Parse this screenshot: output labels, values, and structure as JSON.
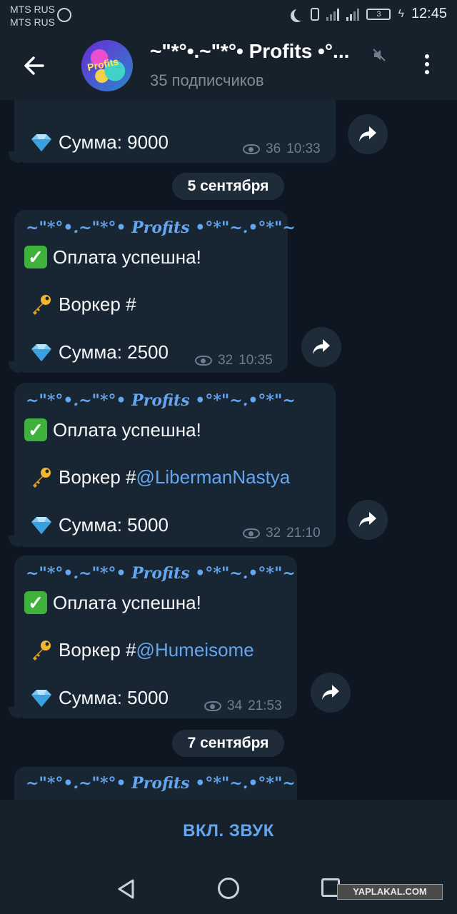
{
  "status_bar": {
    "carrier_1": "MTS RUS",
    "carrier_2": "MTS RUS",
    "battery": "3",
    "time": "12:45"
  },
  "header": {
    "channel_title": "~\"*°•.~\"*°• Profits •°...",
    "subscribers": "35 подписчиков",
    "avatar_text": "Profits"
  },
  "messages": [
    {
      "amount": "Сумма: 9000",
      "views": "36",
      "time": "10:33"
    },
    {
      "channel": "~\"*°•.~\"*°• Profits •°*\"~.•°*\"~",
      "status": "Оплата успешна!",
      "worker_prefix": "Воркер #",
      "worker_mention": "",
      "amount": "Сумма: 2500",
      "views": "32",
      "time": "10:35"
    },
    {
      "channel": "~\"*°•.~\"*°• Profits •°*\"~.•°*\"~",
      "status": "Оплата успешна!",
      "worker_prefix": "Воркер #",
      "worker_mention": "@LibermanNastya",
      "amount": "Сумма: 5000",
      "views": "32",
      "time": "21:10"
    },
    {
      "channel": "~\"*°•.~\"*°• Profits •°*\"~.•°*\"~",
      "status": "Оплата успешна!",
      "worker_prefix": "Воркер #",
      "worker_mention": "@Humeisome",
      "amount": "Сумма: 5000",
      "views": "34",
      "time": "21:53"
    },
    {
      "channel": "~\"*°•.~\"*°• Profits •°*\"~.•°*\"~"
    }
  ],
  "dates": {
    "sep5": "5 сентября",
    "sep7": "7 сентября"
  },
  "bottom": {
    "sound_button": "ВКЛ. ЗВУК"
  },
  "watermark": "YAPLAKAL.COM",
  "colors": {
    "background": "#0e1621",
    "bar": "#17212b",
    "bubble": "#182533",
    "accent": "#64a6f0"
  }
}
